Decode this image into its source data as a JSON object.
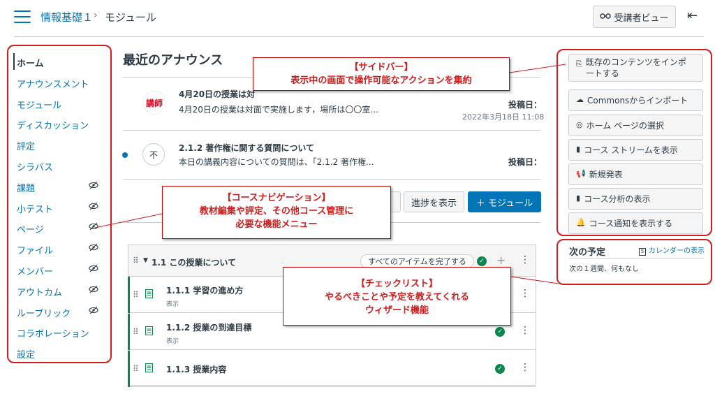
{
  "header": {
    "course_name": "情報基礎１",
    "separator": "›",
    "current_page": "モジュール",
    "student_view_label": "受講者ビュー",
    "student_view_icon": "glasses-icon",
    "collapse_icon": "collapse-left-icon"
  },
  "course_nav": {
    "items": [
      {
        "label": "ホーム",
        "active": true,
        "hidden": false
      },
      {
        "label": "アナウンスメント",
        "active": false,
        "hidden": false
      },
      {
        "label": "モジュール",
        "active": false,
        "hidden": false
      },
      {
        "label": "ディスカッション",
        "active": false,
        "hidden": false
      },
      {
        "label": "評定",
        "active": false,
        "hidden": false
      },
      {
        "label": "シラバス",
        "active": false,
        "hidden": false
      },
      {
        "label": "課題",
        "active": false,
        "hidden": true
      },
      {
        "label": "小テスト",
        "active": false,
        "hidden": true
      },
      {
        "label": "ページ",
        "active": false,
        "hidden": true
      },
      {
        "label": "ファイル",
        "active": false,
        "hidden": true
      },
      {
        "label": "メンバー",
        "active": false,
        "hidden": true
      },
      {
        "label": "アウトカム",
        "active": false,
        "hidden": true
      },
      {
        "label": "ルーブリック",
        "active": false,
        "hidden": true
      },
      {
        "label": "コラボレーション",
        "active": false,
        "hidden": false
      },
      {
        "label": "設定",
        "active": false,
        "hidden": false
      }
    ],
    "hidden_icon": "eye-slash-icon"
  },
  "announcements": {
    "title": "最近のアナウンス",
    "items": [
      {
        "badge": "講師",
        "heading": "4月20日の授業は対",
        "body": "4月20日の授業は対面で実施します，場所は〇〇室...",
        "posted_label": "投稿日：",
        "posted_date": "2022年3月18日 11:08",
        "unread": false
      },
      {
        "badge": "不",
        "heading": "2.1.2 著作権に関する質問について",
        "body": "本日の講義内容についての質問は、「2.1.2 著作権...",
        "posted_label": "投稿日：",
        "posted_date": "",
        "unread": true
      }
    ]
  },
  "module_toolbar": {
    "progress_label": "進捗を表示",
    "add_module_label": "＋ モジュール"
  },
  "module": {
    "title": "1.1 この授業について",
    "requirement": "すべてのアイテムを完了する",
    "items": [
      {
        "title": "1.1.1 学習の進め方",
        "sub": "表示",
        "done": false
      },
      {
        "title": "1.1.2 授業の到達目標",
        "sub": "表示",
        "done": true
      },
      {
        "title": "1.1.3 授業内容",
        "sub": "",
        "done": true
      }
    ]
  },
  "sidebar": {
    "buttons": [
      {
        "icon": "import-icon",
        "label": "既存のコンテンツをインポートする"
      },
      {
        "icon": "commons-icon",
        "label": "Commonsからインポート"
      },
      {
        "icon": "target-icon",
        "label": "ホーム ページの選択"
      },
      {
        "icon": "bar-chart-icon",
        "label": "コース ストリームを表示"
      },
      {
        "icon": "megaphone-icon",
        "label": "新規発表"
      },
      {
        "icon": "bar-chart-icon",
        "label": "コース分析の表示"
      },
      {
        "icon": "bell-icon",
        "label": "コース通知を表示する"
      }
    ]
  },
  "todo": {
    "title": "次の予定",
    "calendar_link": "カレンダーの表示",
    "empty_text": "次の１週間、何もなし"
  },
  "annotations": {
    "sidebar": {
      "title": "【サイドバー】",
      "desc": "表示中の画面で操作可能なアクションを集約"
    },
    "nav": {
      "title": "【コースナビゲーション】",
      "line1": "教材編集や評定、その他コース管理に",
      "line2": "必要な機能メニュー"
    },
    "checklist": {
      "title": "【チェックリスト】",
      "line1": "やるべきことや予定を教えてくれる",
      "line2": "ウィザード機能"
    },
    "color": "#d01c1c"
  }
}
